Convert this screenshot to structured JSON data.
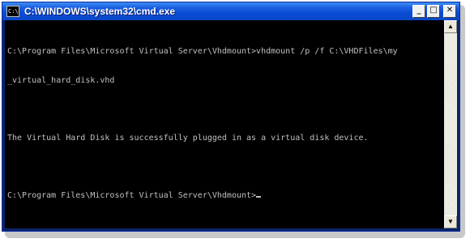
{
  "window": {
    "title": "C:\\WINDOWS\\system32\\cmd.exe",
    "icon_glyph": "C:\\",
    "minimize_glyph": "_",
    "maximize_glyph": "□",
    "close_glyph": "✕"
  },
  "console": {
    "line1": "C:\\Program Files\\Microsoft Virtual Server\\Vhdmount>vhdmount /p /f C:\\VHDFiles\\my",
    "line2": "_virtual_hard_disk.vhd",
    "line3": "The Virtual Hard Disk is successfully plugged in as a virtual disk device.",
    "line4": "C:\\Program Files\\Microsoft Virtual Server\\Vhdmount>"
  },
  "scrollbar": {
    "up_glyph": "▲",
    "down_glyph": "▼"
  },
  "colors": {
    "console_bg": "#000000",
    "console_text": "#c0c0c0",
    "titlebar": "#0a4bd6"
  },
  "icons": [
    "cmd-app-icon",
    "minimize-icon",
    "maximize-icon",
    "close-icon",
    "scroll-up-icon",
    "scroll-down-icon"
  ]
}
